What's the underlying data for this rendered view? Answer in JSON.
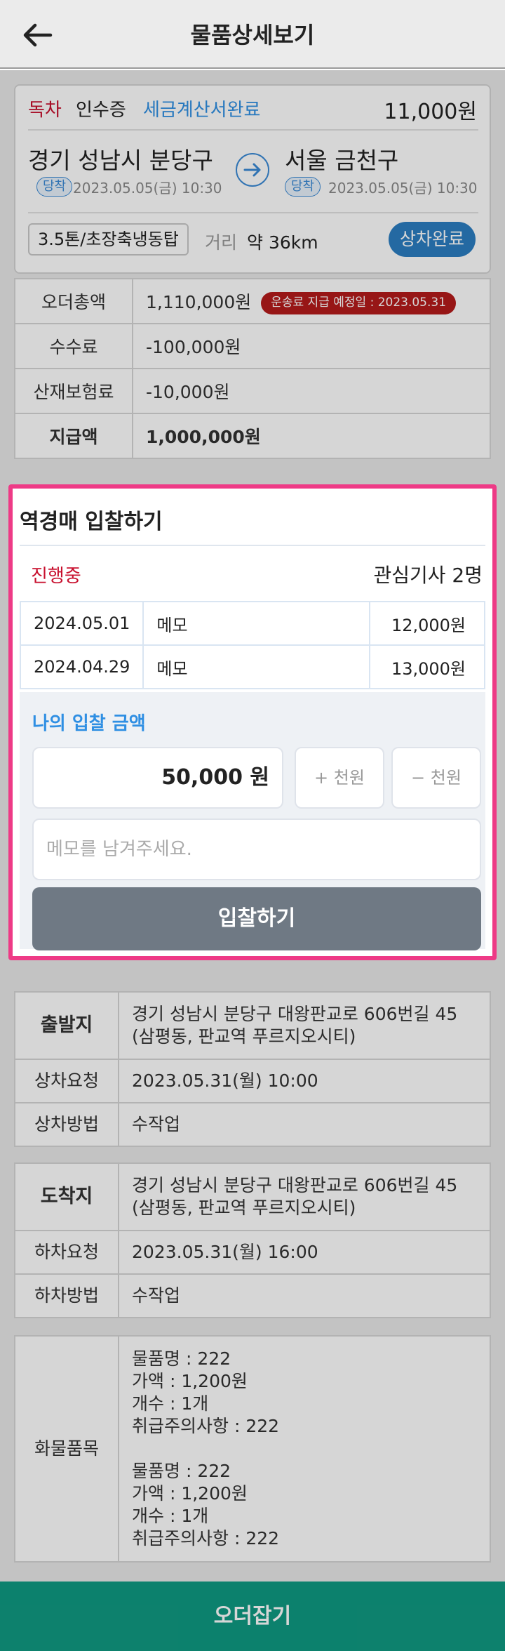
{
  "header": {
    "title": "물품상세보기"
  },
  "summary": {
    "status_dock": "독차",
    "status_receipt": "인수증",
    "status_tax": "세금계산서완료",
    "amount": "11,000원",
    "origin": "경기 성남시 분당구",
    "origin_tag": "당착",
    "origin_time": "2023.05.05(금) 10:30",
    "dest": "서울 금천구",
    "dest_tag": "당착",
    "dest_time": "2023.05.05(금) 10:30",
    "vehicle": "3.5톤/초장축냉동탑",
    "distance_label": "거리",
    "distance_value": "약 36km",
    "load_status": "상차완료"
  },
  "fees": {
    "rows": [
      {
        "label": "오더총액",
        "value": "1,110,000원",
        "badge": "운송료 지급 예정일 : 2023.05.31"
      },
      {
        "label": "수수료",
        "value": "-100,000원"
      },
      {
        "label": "산재보험료",
        "value": "-10,000원"
      },
      {
        "label": "지급액",
        "value": "1,000,000원"
      }
    ]
  },
  "bid": {
    "title": "역경매 입찰하기",
    "status": "진행중",
    "interest": "관심기사 2명",
    "rows": [
      {
        "date": "2024.05.01",
        "memo": "메모",
        "price": "12,000원"
      },
      {
        "date": "2024.04.29",
        "memo": "메모",
        "price": "13,000원"
      }
    ],
    "my_label": "나의 입찰 금액",
    "amount": "50,000 원",
    "plus": "+ 천원",
    "minus": "− 천원",
    "memo_placeholder": "메모를 남겨주세요.",
    "submit": "입찰하기"
  },
  "details": {
    "origin": {
      "label": "출발지",
      "address": "경기 성남시 분당구 대왕판교로 606번길 45 (삼평동, 판교역 푸르지오시티)",
      "req_label": "상차요청",
      "req_value": "2023.05.31(월) 10:00",
      "method_label": "상차방법",
      "method_value": "수작업"
    },
    "dest": {
      "label": "도착지",
      "address": "경기 성남시 분당구 대왕판교로 606번길 45 (삼평동, 판교역 푸르지오시티)",
      "req_label": "하차요청",
      "req_value": "2023.05.31(월) 16:00",
      "method_label": "하차방법",
      "method_value": "수작업"
    },
    "cargo": {
      "label": "화물품목",
      "items": [
        {
          "name": "물품명 : 222",
          "price": "가액 : 1,200원",
          "count": "개수 : 1개",
          "caution": "취급주의사항 : 222"
        },
        {
          "name": "물품명 : 222",
          "price": "가액 : 1,200원",
          "count": "개수 : 1개",
          "caution": "취급주의사항 : 222"
        }
      ]
    }
  },
  "footer": {
    "order_button": "오더잡기"
  },
  "colors": {
    "accent_blue": "#2f8fe3",
    "status_red": "#c8102e",
    "bottom_green": "#0f9a82",
    "modal_border": "#ee3a86"
  }
}
